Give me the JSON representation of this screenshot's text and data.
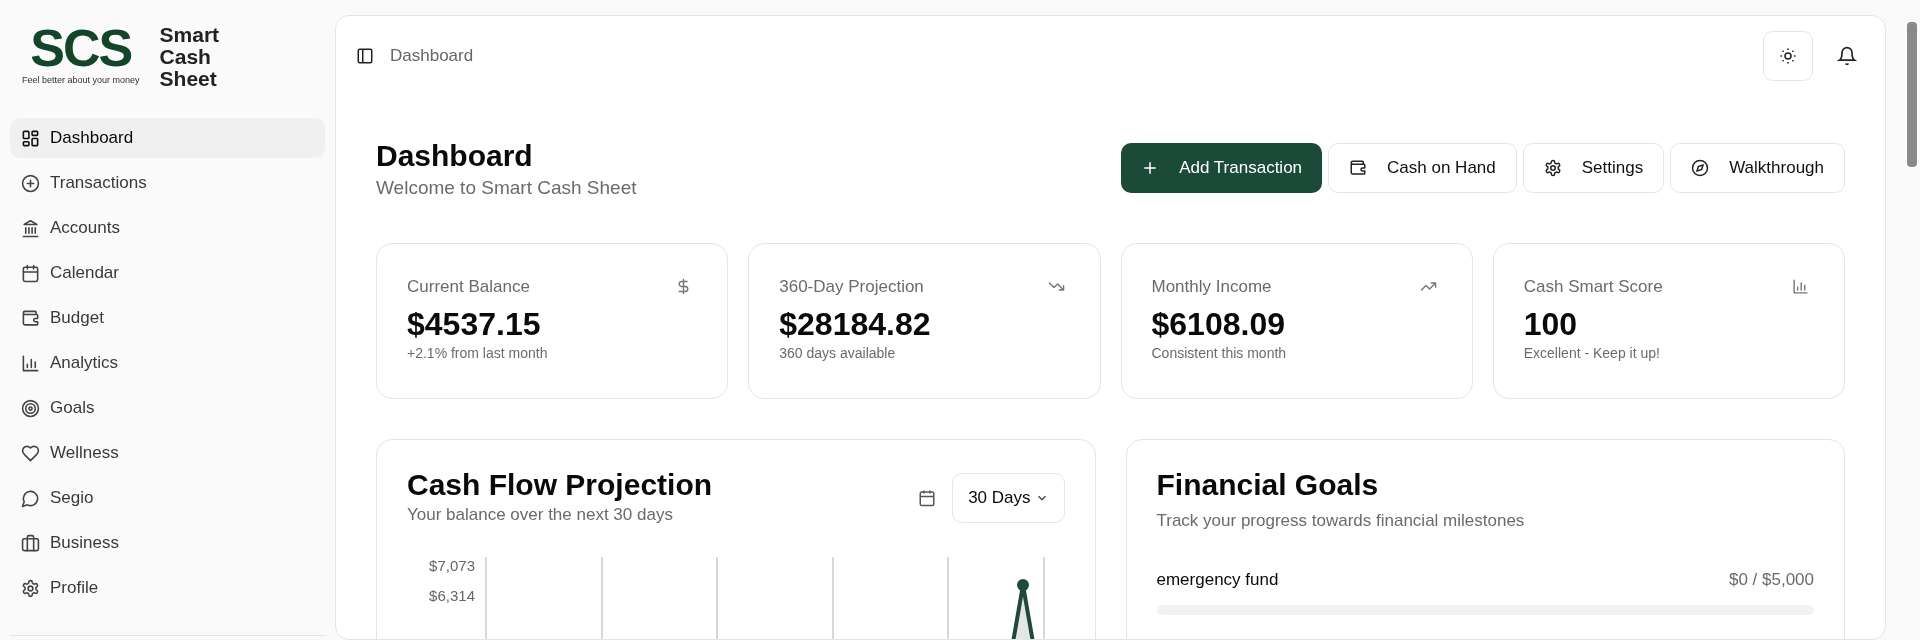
{
  "brand": {
    "logo_text": "SCS",
    "tagline": "Feel better about your money",
    "name_lines": [
      "Smart",
      "Cash",
      "Sheet"
    ]
  },
  "sidebar": {
    "items": [
      {
        "label": "Dashboard",
        "selected": true
      },
      {
        "label": "Transactions",
        "selected": false
      },
      {
        "label": "Accounts",
        "selected": false
      },
      {
        "label": "Calendar",
        "selected": false
      },
      {
        "label": "Budget",
        "selected": false
      },
      {
        "label": "Analytics",
        "selected": false
      },
      {
        "label": "Goals",
        "selected": false
      },
      {
        "label": "Wellness",
        "selected": false
      },
      {
        "label": "Segio",
        "selected": false
      },
      {
        "label": "Business",
        "selected": false
      },
      {
        "label": "Profile",
        "selected": false
      }
    ]
  },
  "breadcrumb": "Dashboard",
  "header": {
    "title": "Dashboard",
    "subtitle": "Welcome to Smart Cash Sheet"
  },
  "actions": [
    {
      "label": "Add Transaction",
      "kind": "primary"
    },
    {
      "label": "Cash on Hand",
      "kind": "outline"
    },
    {
      "label": "Settings",
      "kind": "outline"
    },
    {
      "label": "Walkthrough",
      "kind": "outline"
    }
  ],
  "stats": [
    {
      "label": "Current Balance",
      "value": "$4537.15",
      "note": "+2.1% from last month"
    },
    {
      "label": "360-Day Projection",
      "value": "$28184.82",
      "note": "360 days available"
    },
    {
      "label": "Monthly Income",
      "value": "$6108.09",
      "note": "Consistent this month"
    },
    {
      "label": "Cash Smart Score",
      "value": "100",
      "note": "Excellent - Keep it up!"
    }
  ],
  "cash_flow": {
    "title": "Cash Flow Projection",
    "subtitle": "Your balance over the next 30 days",
    "range": "30 Days",
    "y_labels": [
      "$7,073",
      "$6,314"
    ]
  },
  "goals": {
    "title": "Financial Goals",
    "subtitle": "Track your progress towards financial milestones",
    "items": [
      {
        "name": "emergency fund",
        "amount": "$0 / $5,000",
        "level": 0
      }
    ]
  }
}
